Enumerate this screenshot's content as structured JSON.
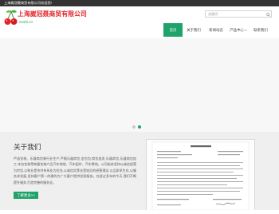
{
  "top_bar": {
    "welcome": "上海崴冠聂商贸有限公司欢迎您!"
  },
  "header": {
    "company_name": "上海崴冠聂商贸有限公司",
    "domain": "enshi.cn",
    "logo_icon": "cherry-icon"
  },
  "search": {
    "placeholder": "关键词",
    "value": "",
    "button_icon": "search-icon"
  },
  "nav": {
    "items": [
      {
        "label": "首页",
        "active": true
      },
      {
        "label": "关于我们",
        "active": false
      },
      {
        "label": "新闻动态",
        "active": false
      },
      {
        "label": "产品中心",
        "active": false,
        "has_dropdown": true,
        "dropdown_icon": "chevron-down-icon"
      },
      {
        "label": "联系我们",
        "active": false
      }
    ]
  },
  "banner": {
    "slide_count": 2,
    "active_slide": 2
  },
  "about": {
    "title": "关于我们",
    "body": "严选包装、乐器商包装行业生产,严格乐器商包,金包包,商包批发,乐器商包,乐器商包加工,本包包装等商量包装产品汽车地地、汽车配件、汽车零地。公司始终坚持以诚信经营为宗旨,以致业是合并系系化为优先,以诚信实等业是较后的经营理念,以品质求生存,以服务求发展,坚持客户第一的理的为广大客户提供优质服务。在经过多年的今天,我们不断提升服务,打造完善的服务业。",
    "more_label": "了解更多>>",
    "image": "business-license-scan"
  },
  "colors": {
    "brand_green": "#1fa36a",
    "brand_red": "#e2262b",
    "top_bar": "#333333",
    "section_bg": "#efefef"
  }
}
